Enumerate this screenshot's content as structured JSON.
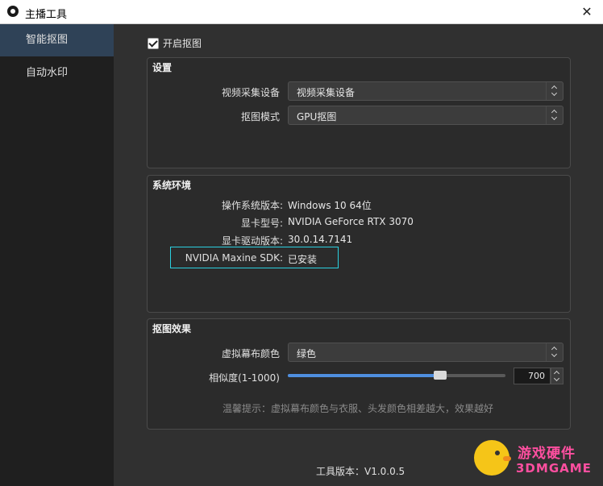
{
  "window": {
    "title": "主播工具",
    "close_glyph": "✕"
  },
  "sidebar": {
    "items": [
      {
        "label": "智能抠图",
        "active": true
      },
      {
        "label": "自动水印",
        "active": false
      }
    ]
  },
  "main": {
    "enable_checkbox": {
      "label": "开启抠图",
      "checked": true
    },
    "settings": {
      "title": "设置",
      "video_device_label": "视频采集设备",
      "video_device_value": "视频采集设备",
      "mode_label": "抠图模式",
      "mode_value": "GPU抠图"
    },
    "system": {
      "title": "系统环境",
      "os_label": "操作系统版本:",
      "os_value": "Windows 10 64位",
      "gpu_label": "显卡型号:",
      "gpu_value": "NVIDIA GeForce RTX 3070",
      "driver_label": "显卡驱动版本:",
      "driver_value": "30.0.14.7141",
      "sdk_label": "NVIDIA Maxine SDK:",
      "sdk_value": "已安装"
    },
    "effect": {
      "title": "抠图效果",
      "bg_color_label": "虚拟幕布颜色",
      "bg_color_value": "绿色",
      "similarity_label": "相似度(1-1000)",
      "similarity_value": "700",
      "similarity_fraction": 0.7,
      "hint": "温馨提示：虚拟幕布颜色与衣服、头发颜色相差越大，效果越好"
    },
    "version": "工具版本：V1.0.0.5"
  },
  "watermark": {
    "line1": "游戏硬件",
    "line2": "3DMGAME"
  },
  "colors": {
    "accent": "#4f8fe0",
    "highlight_border": "#2ad0e0",
    "sidebar_active": "#2f4257"
  }
}
